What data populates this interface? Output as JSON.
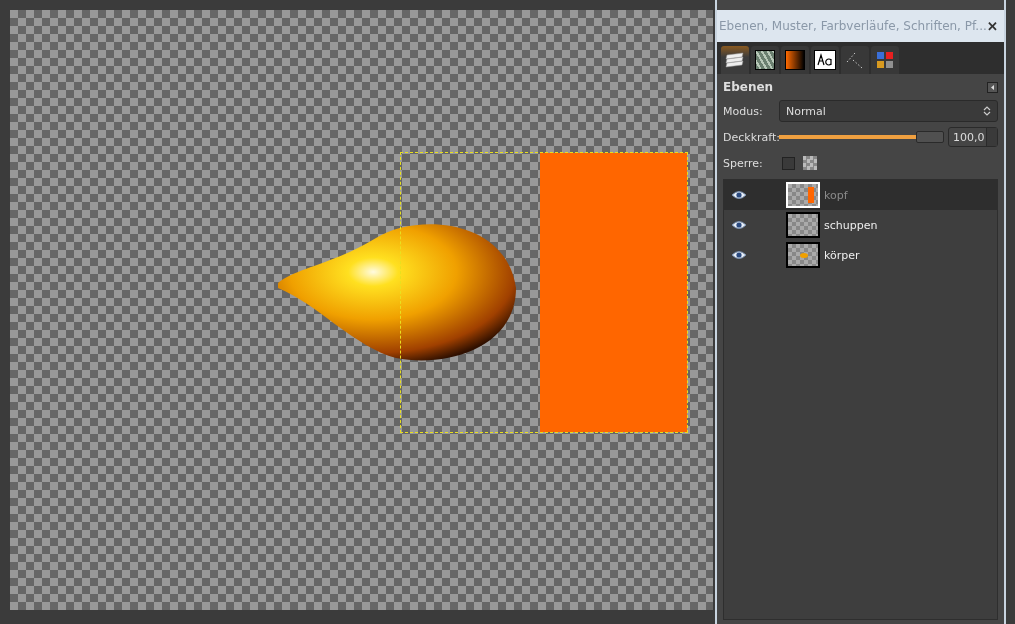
{
  "dock": {
    "title": "Ebenen, Muster, Farbverläufe, Schriften, Pf...",
    "close": "✕",
    "tabs": [
      {
        "kind": "layers",
        "selected": true
      },
      {
        "kind": "patterns",
        "selected": false
      },
      {
        "kind": "gradients",
        "selected": false
      },
      {
        "kind": "fonts",
        "selected": false
      },
      {
        "kind": "paths",
        "selected": false
      },
      {
        "kind": "colors",
        "selected": false
      }
    ],
    "heading": "Ebenen",
    "mode": {
      "label": "Modus:",
      "value": "Normal"
    },
    "opacity": {
      "label": "Deckkraft:",
      "level": 1,
      "value": "100,0"
    },
    "lock": {
      "label": "Sperre:",
      "pixels_locked": false,
      "alpha_locked": false
    },
    "layers": [
      {
        "name": "kopf",
        "visible": true,
        "selected": true,
        "kind": "rect"
      },
      {
        "name": "schuppen",
        "visible": true,
        "selected": false,
        "kind": "empty"
      },
      {
        "name": "körper",
        "visible": true,
        "selected": false,
        "kind": "fish"
      }
    ]
  }
}
